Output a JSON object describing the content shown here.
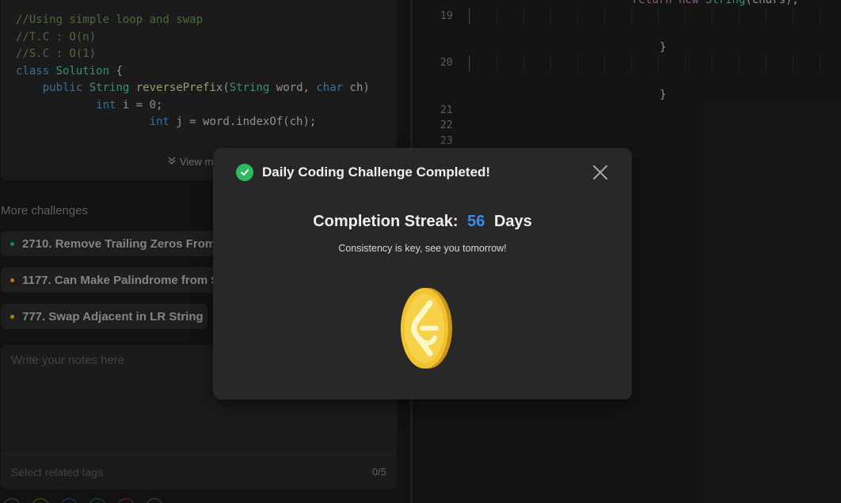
{
  "code_preview": {
    "lines": [
      "//Using simple loop and swap",
      "//T.C : O(n)",
      "//S.C : O(1)"
    ],
    "class_kw": "class",
    "class_name": "Solution",
    "method_mod": "public",
    "method_type": "String",
    "method_name": "reversePrefix",
    "param_type1": "String",
    "param_name1": "word,",
    "param_type2": "char",
    "param_name2": "ch)",
    "int_kw": "int",
    "int_i_rest": "i = ",
    "int_i_val": "0",
    "int_j_rest": "j = word.indexOf(ch);",
    "view_more": "View m"
  },
  "more_challenges": {
    "title": "More challenges",
    "items": [
      {
        "label": "2710. Remove Trailing Zeros From",
        "color": "#1cbaba"
      },
      {
        "label": "1177. Can Make Palindrome from S",
        "color": "#ffb800"
      },
      {
        "label": "777. Swap Adjacent in LR String",
        "color": "#ffb800"
      }
    ]
  },
  "notes": {
    "placeholder": "Write your notes here",
    "tags_placeholder": "Select related tags",
    "tags_count": "0/5"
  },
  "editor": {
    "line_numbers": [
      "19",
      "20",
      "21",
      "22",
      "23"
    ],
    "brace": "}",
    "return_kw": "return new ",
    "return_type": "String",
    "return_rest": "(chars);"
  },
  "modal": {
    "title": "Daily Coding Challenge Completed!",
    "streak_label": "Completion Streak:",
    "streak_value": "56",
    "streak_unit": "Days",
    "subtitle": "Consistency is key, see you tomorrow!",
    "icons": {
      "status": "check-circle-icon",
      "close": "close-icon",
      "reward": "coin-icon"
    },
    "accent": "#3b8ded",
    "success": "#2cbb5d"
  }
}
